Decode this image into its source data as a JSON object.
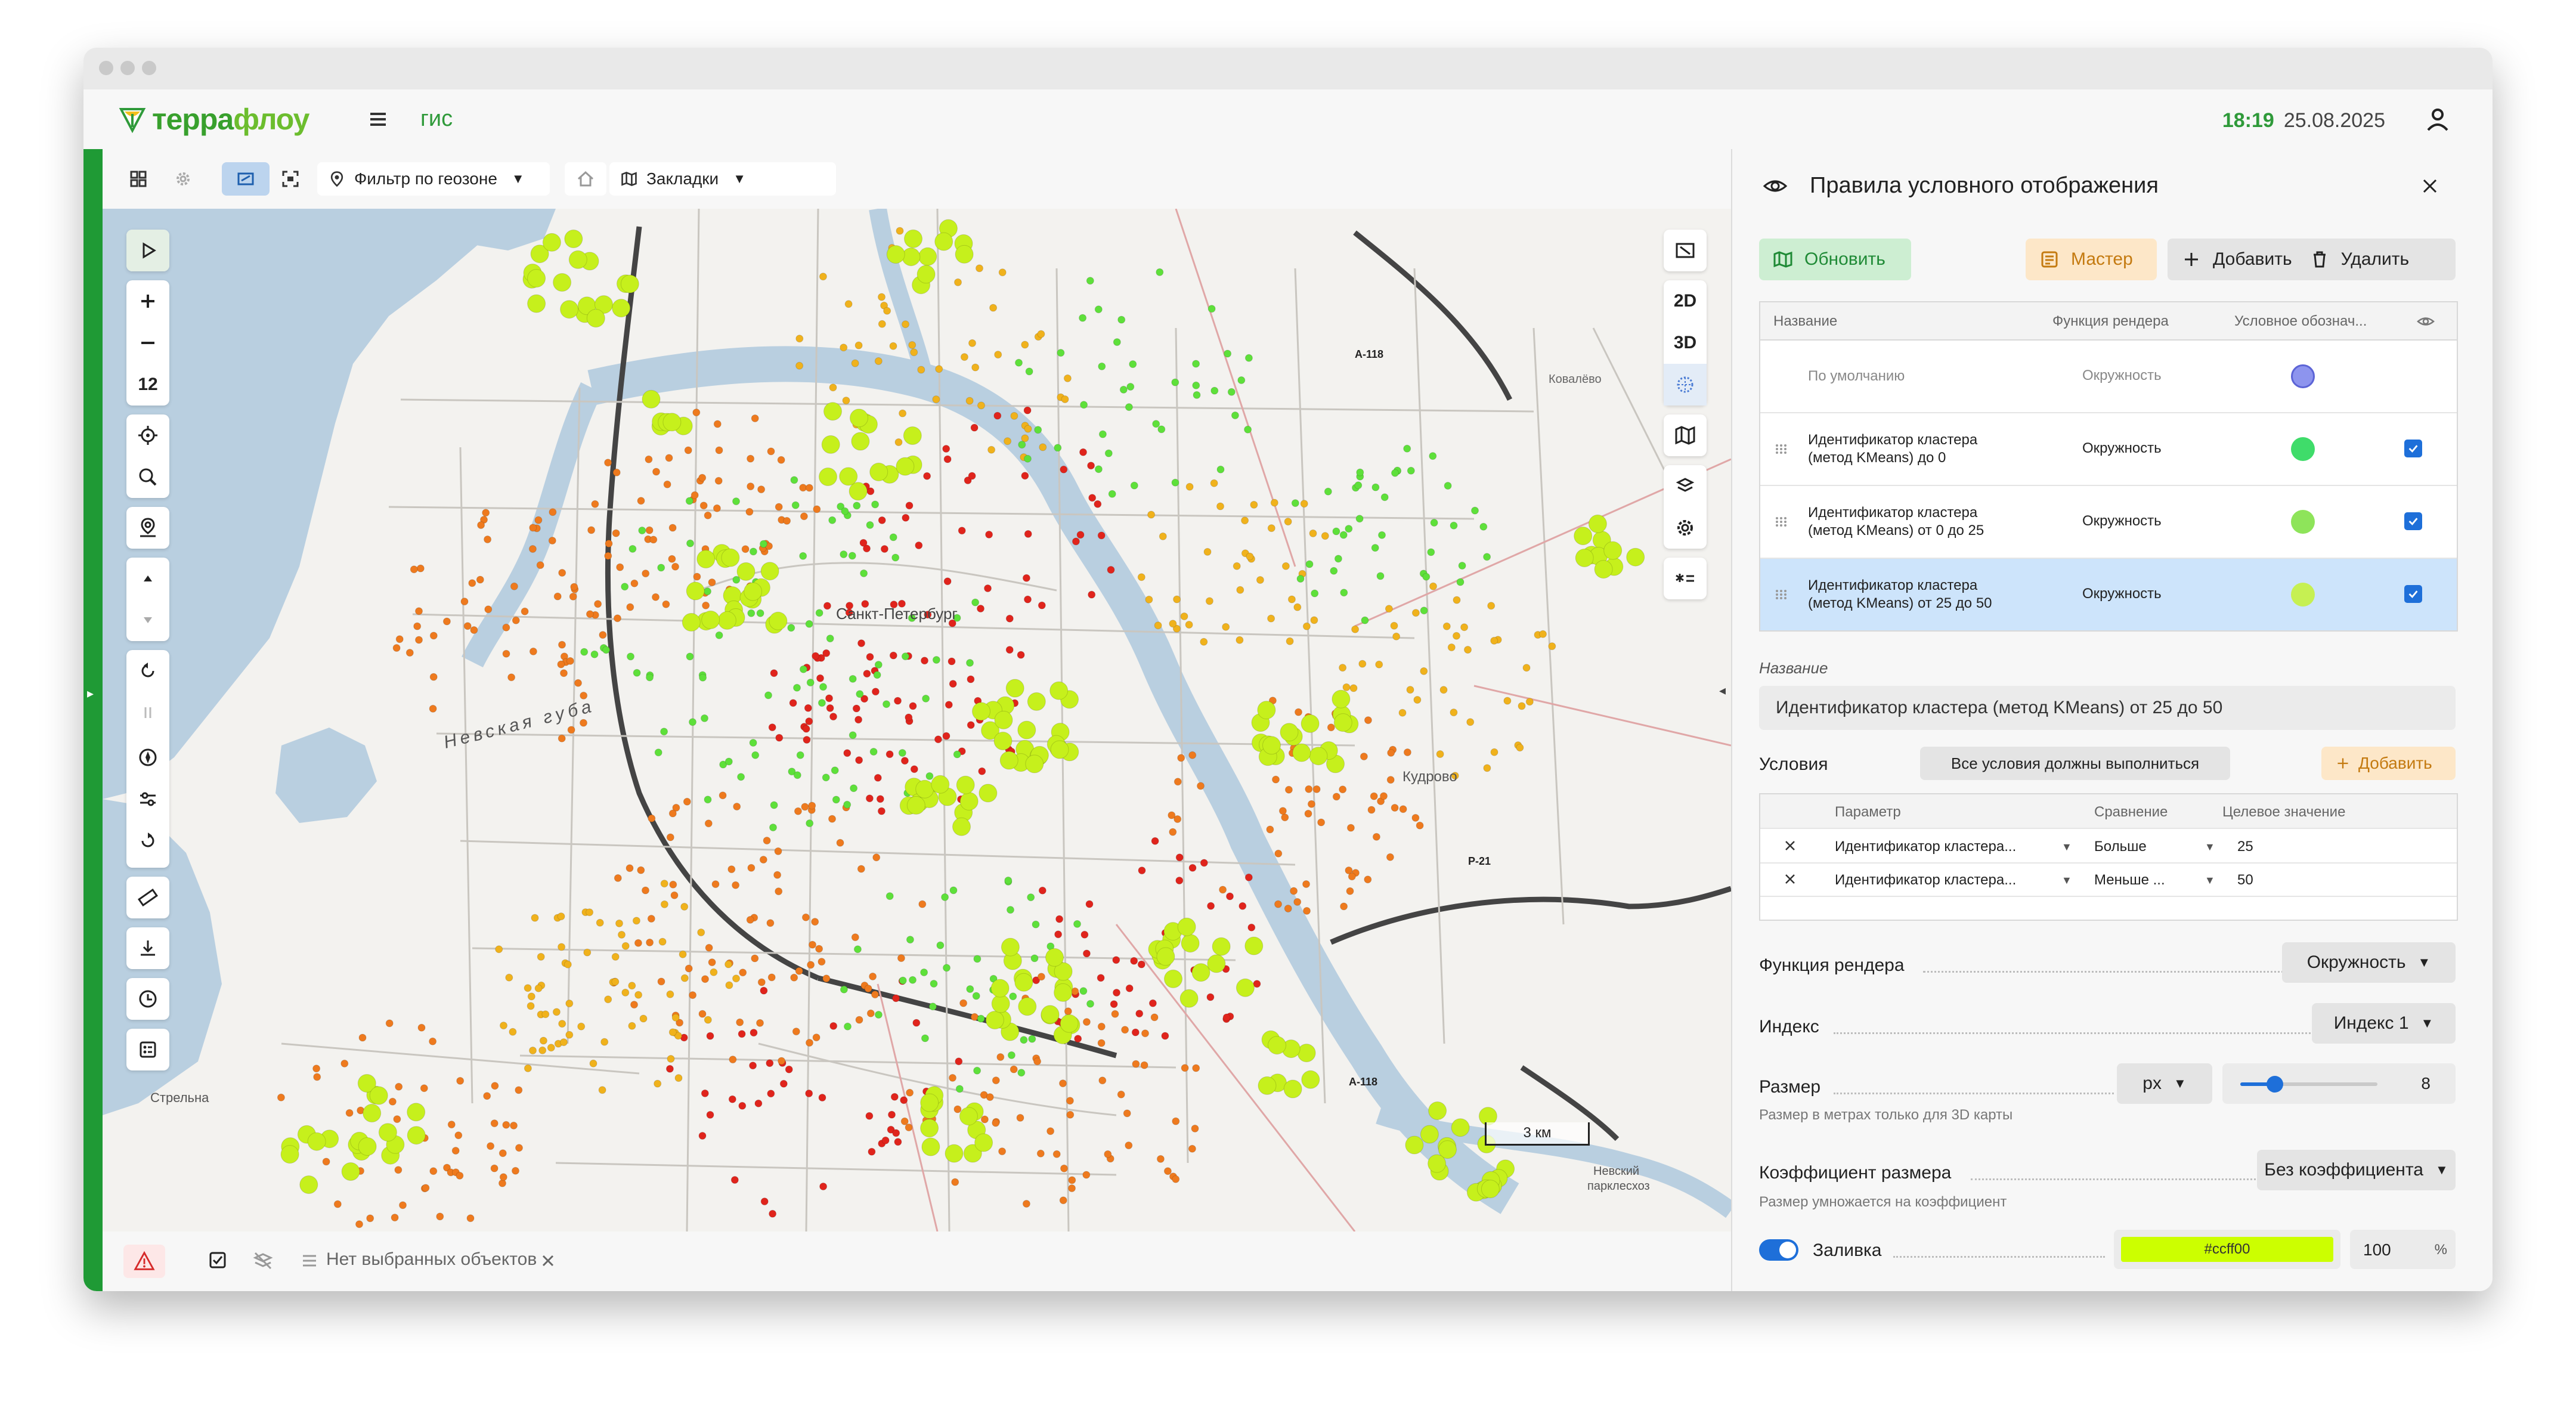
{
  "app": {
    "logo_text_part1": "терра",
    "logo_text_part2": "флоу",
    "section": "гис",
    "time": "18:19",
    "date": "25.08.2025"
  },
  "map_toolbar": {
    "geozone_filter": "Фильтр по геозоне",
    "bookmarks": "Закладки"
  },
  "map_controls": {
    "zoom_level": "12",
    "view_2d": "2D",
    "view_3d": "3D"
  },
  "map_labels": {
    "city": "Санкт-Петербург",
    "bay": "Невская губа",
    "kudrovo": "Кудрово",
    "kovalevo": "Ковалёво",
    "strelna": "Стрельна",
    "park_line1": "Невский",
    "park_line2": "парклесхоз",
    "road_a118_top": "А-118",
    "road_a118_bottom": "А-118",
    "road_p21": "Р-21",
    "scale": "3 км"
  },
  "status_bar": {
    "selection": "Нет выбранных объектов"
  },
  "panel": {
    "title": "Правила условного отображения",
    "refresh": "Обновить",
    "wizard": "Мастер",
    "add": "Добавить",
    "delete": "Удалить",
    "table_headers": {
      "name": "Название",
      "render_fn": "Функция рендера",
      "legend": "Условное обознач..."
    },
    "rules": [
      {
        "name": "По умолчанию",
        "name2": "",
        "fn": "Окружность",
        "color": "#8d94ee",
        "checkbox": false
      },
      {
        "name": "Идентификатор кластера",
        "name2": "(метод KMeans) до 0",
        "fn": "Окружность",
        "color": "#3fdc6a",
        "checkbox": true
      },
      {
        "name": "Идентификатор кластера",
        "name2": "(метод KMeans) от 0 до 25",
        "fn": "Окружность",
        "color": "#8ee45a",
        "checkbox": true
      },
      {
        "name": "Идентификатор кластера",
        "name2": "(метод KMeans) от 25 до 50",
        "fn": "Окружность",
        "color": "#c6f052",
        "checkbox": true
      }
    ],
    "name_label": "Название",
    "name_value": "Идентификатор кластера (метод KMeans) от 25 до 50",
    "conditions_label": "Условия",
    "conditions_mode": "Все условия должны выполниться",
    "conditions_add": "Добавить",
    "cond_headers": {
      "param": "Параметр",
      "compare": "Сравнение",
      "target": "Целевое значение"
    },
    "conditions": [
      {
        "param": "Идентификатор кластера...",
        "compare": "Больше",
        "value": "25"
      },
      {
        "param": "Идентификатор кластера...",
        "compare": "Меньше ...",
        "value": "50"
      }
    ],
    "render_fn_label": "Функция рендера",
    "render_fn_value": "Окружность",
    "index_label": "Индекс",
    "index_value": "Индекс 1",
    "size_label": "Размер",
    "size_unit": "px",
    "size_value": "8",
    "size_slider_fraction": 0.25,
    "size_hint": "Размер в метрах только для 3D карты",
    "coef_label": "Коэффициент размера",
    "coef_value": "Без коэффициента",
    "coef_hint": "Размер умножается на коэффициент",
    "fill_label": "Заливка",
    "fill_enabled": true,
    "fill_color": "#ccff00",
    "fill_opacity": "100",
    "fill_opacity_unit": "%"
  },
  "colors": {
    "brand_green": "#2f9a3a",
    "accent_blue": "#1e6fd9",
    "point_red": "#e0241c",
    "point_orange": "#ee7a1e",
    "point_yellow": "#f0b21c",
    "point_lime": "#c6f01c",
    "point_green": "#5ee03a"
  }
}
